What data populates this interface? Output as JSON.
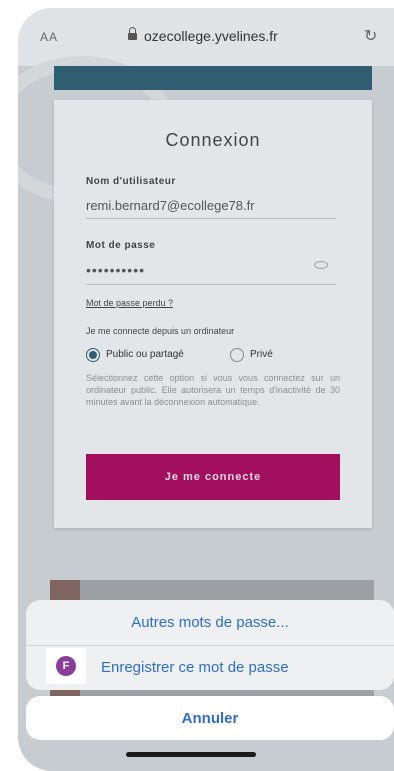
{
  "browser": {
    "text_size_label": "AA",
    "url": "ozecollege.yvelines.fr",
    "lock_icon": "lock-icon",
    "reload_icon": "reload-icon"
  },
  "login": {
    "title": "Connexion",
    "username_label": "Nom d'utilisateur",
    "username_value": "remi.bernard7@ecollege78.fr",
    "password_label": "Mot de passe",
    "password_value": "••••••••••",
    "forgot_link": "Mot de passe perdu ?",
    "connect_from_label": "Je me connecte depuis un ordinateur",
    "options": [
      {
        "label": "Public ou partagé",
        "selected": true
      },
      {
        "label": "Privé",
        "selected": false
      }
    ],
    "help_text": "Sélectionnez cette option si vous vous connectez sur un ordinateur public. Elle autorisera un temps d'inactivité de 30 minutes avant la déconnexion automatique.",
    "submit_label": "Je me connecte",
    "accent_color": "#a30f5f",
    "header_color": "#2f5d72"
  },
  "sheet": {
    "other_passwords": "Autres mots de passe...",
    "save_password": "Enregistrer ce mot de passe",
    "badge_letter": "F",
    "cancel": "Annuler",
    "action_color": "#2e6fc9"
  }
}
